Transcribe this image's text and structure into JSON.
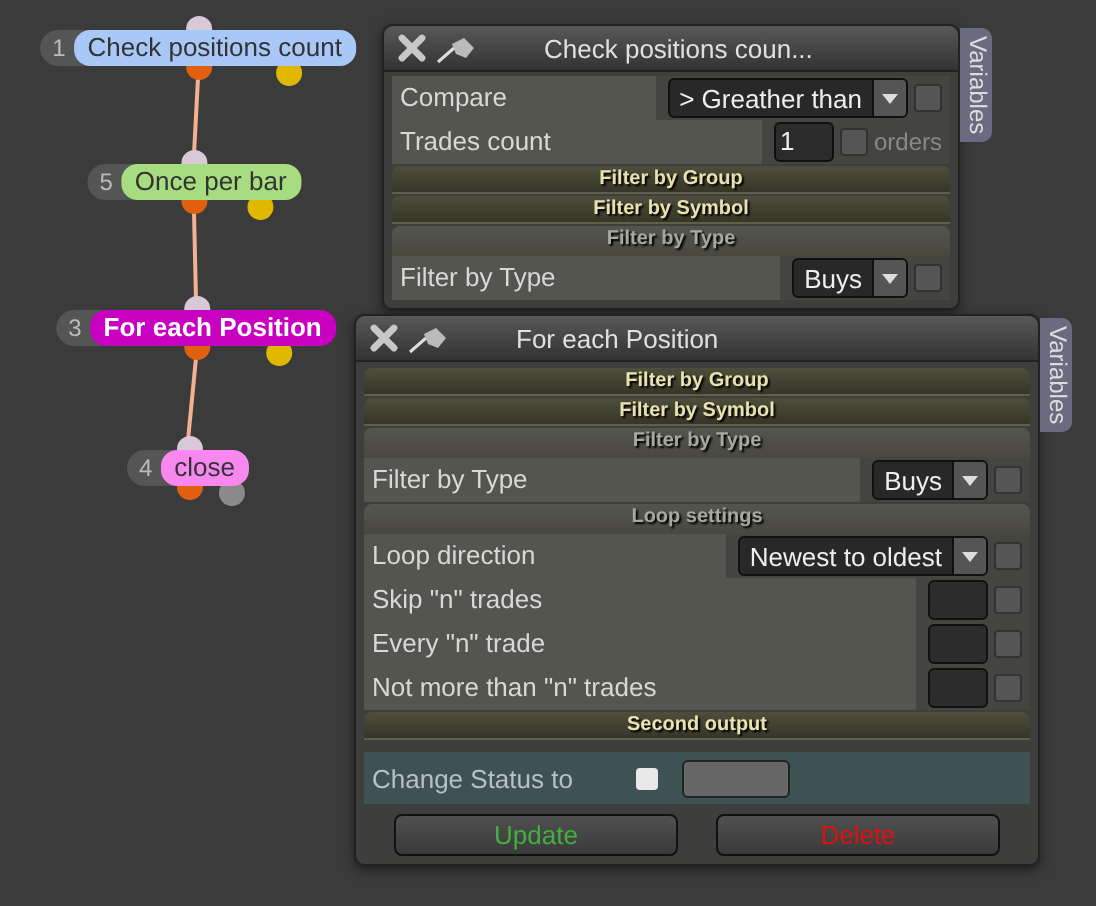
{
  "nodes": [
    {
      "number": "1",
      "label": "Check positions count",
      "color": "#a8c8f8",
      "selected": false,
      "second_port_active": true
    },
    {
      "number": "5",
      "label": "Once per bar",
      "color": "#a8dc80",
      "selected": false,
      "second_port_active": true
    },
    {
      "number": "3",
      "label": "For each Position",
      "color": "#c800c0",
      "selected": true,
      "second_port_active": true
    },
    {
      "number": "4",
      "label": "close",
      "color": "#f888f0",
      "selected": false,
      "second_port_active": false
    }
  ],
  "windows": [
    {
      "title": "Check positions coun...",
      "side_tab": "Variables",
      "items": [
        {
          "kind": "dropdown",
          "label": "Compare",
          "value": "> Greather than",
          "checked": false
        },
        {
          "kind": "number",
          "label": "Trades count",
          "value": "1",
          "checked": false,
          "suffix": "orders"
        },
        {
          "kind": "section",
          "label": "Filter by Group",
          "expanded": false
        },
        {
          "kind": "section",
          "label": "Filter by Symbol",
          "expanded": false
        },
        {
          "kind": "section",
          "label": "Filter by Type",
          "expanded": true
        },
        {
          "kind": "dropdown",
          "label": "Filter by Type",
          "value": "Buys",
          "checked": false
        }
      ]
    },
    {
      "title": "For each Position",
      "side_tab": "Variables",
      "items": [
        {
          "kind": "section",
          "label": "Filter by Group",
          "expanded": false
        },
        {
          "kind": "section",
          "label": "Filter by Symbol",
          "expanded": false
        },
        {
          "kind": "section",
          "label": "Filter by Type",
          "expanded": true
        },
        {
          "kind": "dropdown",
          "label": "Filter by Type",
          "value": "Buys",
          "checked": false
        },
        {
          "kind": "section",
          "label": "Loop settings",
          "expanded": true
        },
        {
          "kind": "dropdown",
          "label": "Loop direction",
          "value": "Newest to oldest",
          "checked": false
        },
        {
          "kind": "number",
          "label": "Skip \"n\" trades",
          "checked": false
        },
        {
          "kind": "number",
          "label": "Every \"n\" trade",
          "checked": false
        },
        {
          "kind": "number",
          "label": "Not more than \"n\" trades",
          "checked": false
        },
        {
          "kind": "section",
          "label": "Second output",
          "expanded": false
        },
        {
          "kind": "status",
          "label": "Change Status to",
          "checked": false
        }
      ],
      "buttons": [
        {
          "label": "Update",
          "color": "#40b040"
        },
        {
          "label": "Delete",
          "color": "#e01010"
        }
      ]
    }
  ]
}
